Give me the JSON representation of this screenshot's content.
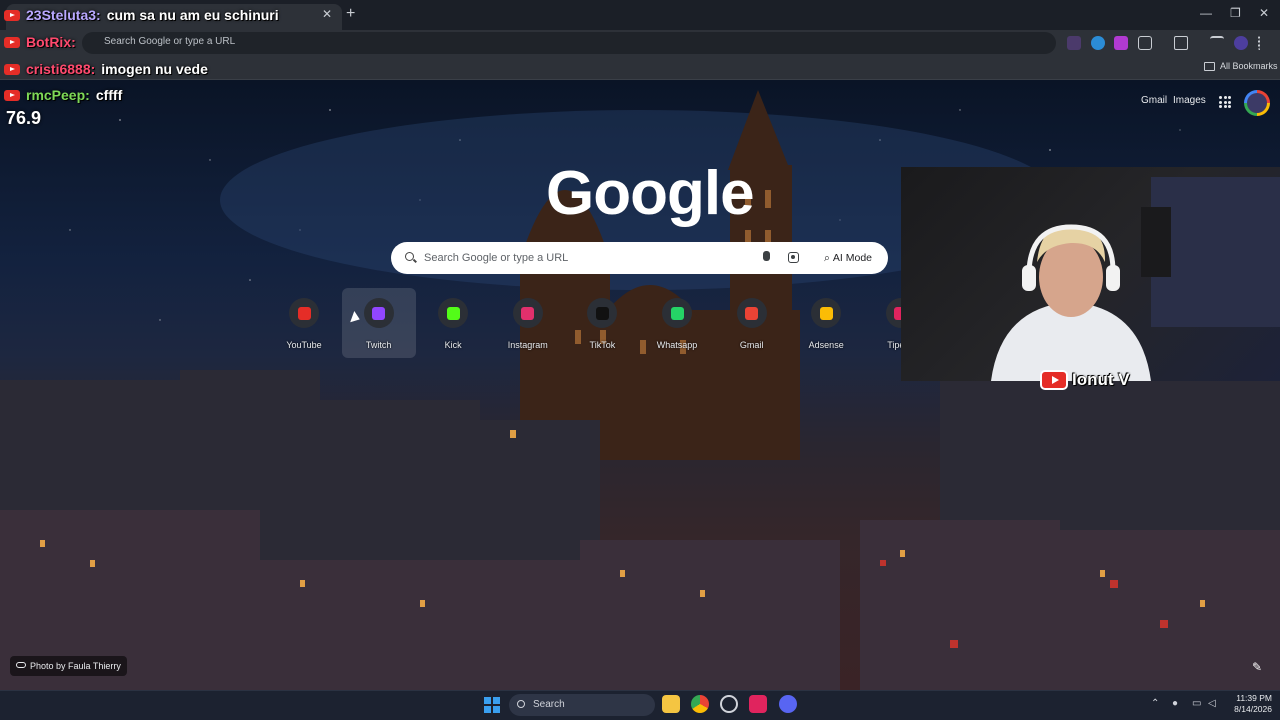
{
  "browser": {
    "omnibox_placeholder": "Search Google or type a URL",
    "bookmarks_all_label": "All Bookmarks"
  },
  "chat": [
    {
      "user": "23Steluta3:",
      "message": "cum sa nu am eu schinuri"
    },
    {
      "user": "BotRix:",
      "message": ""
    },
    {
      "user": "cristi6888:",
      "message": "imogen nu vede"
    },
    {
      "user": "rmcPeep:",
      "message": "cffff"
    }
  ],
  "counter_value": "76.9",
  "ntp": {
    "top_links": [
      "Gmail",
      "Images"
    ],
    "logo": "Google",
    "search_placeholder": "Search Google or type a URL",
    "ai_mode_label": "AI Mode",
    "shortcuts": [
      {
        "label": "YouTube",
        "icon": "youtube-icon",
        "color": "#e52d27"
      },
      {
        "label": "Twitch",
        "icon": "twitch-icon",
        "color": "#9146ff"
      },
      {
        "label": "Kick",
        "icon": "kick-icon",
        "color": "#53fc18"
      },
      {
        "label": "Instagram",
        "icon": "instagram-icon",
        "color": "#e1306c"
      },
      {
        "label": "TikTok",
        "icon": "tiktok-icon",
        "color": "#111111"
      },
      {
        "label": "Whatsapp",
        "icon": "whatsapp-icon",
        "color": "#25d366"
      },
      {
        "label": "Gmail",
        "icon": "gmail-icon",
        "color": "#ea4335"
      },
      {
        "label": "Adsense",
        "icon": "adsense-icon",
        "color": "#fbbc05"
      },
      {
        "label": "Tipeee",
        "icon": "tipeee-icon",
        "color": "#e0245e"
      }
    ],
    "photo_credit": "Photo by Faula Thierry"
  },
  "webcam": {
    "name": "Ionut V"
  },
  "taskbar": {
    "search_label": "Search",
    "time": "11:39 PM",
    "date": "8/14/2026"
  }
}
